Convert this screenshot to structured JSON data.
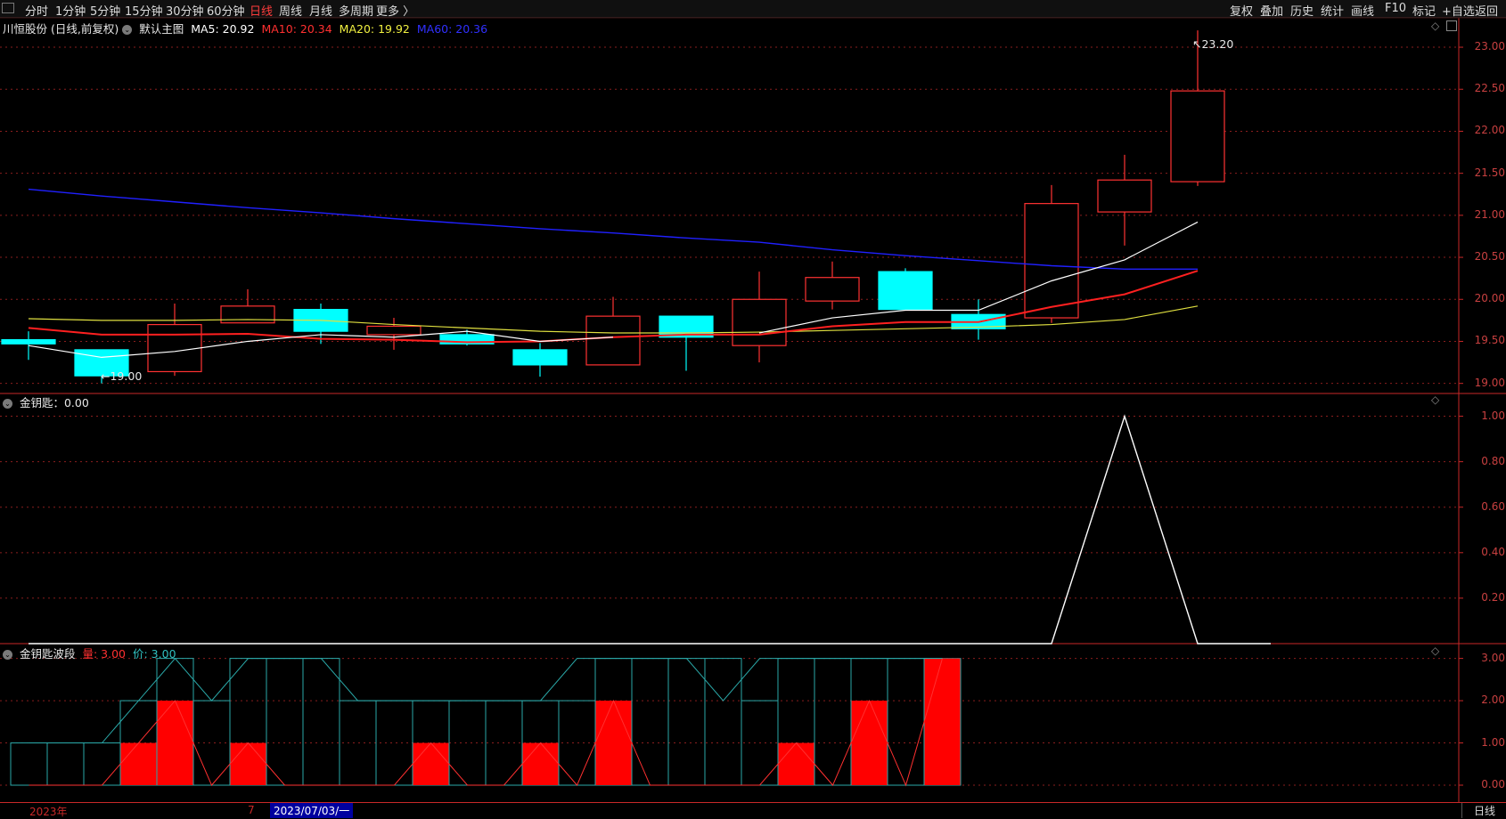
{
  "toolbar": {
    "periods": [
      "分时",
      "1分钟",
      "5分钟",
      "15分钟",
      "30分钟",
      "60分钟",
      "日线",
      "周线",
      "月线",
      "多周期",
      "更多 〉"
    ],
    "active_period": "日线",
    "right_buttons": [
      "复权",
      "叠加",
      "历史",
      "统计",
      "画线",
      "F10",
      "标记",
      "+自选",
      "返回"
    ]
  },
  "main_panel": {
    "stock_name": "川恒股份",
    "mode": "(日线,前复权)",
    "template": "默认主图",
    "ma5_label": "MA5: 20.92",
    "ma10_label": "MA10: 20.34",
    "ma20_label": "MA20: 19.92",
    "ma60_label": "MA60: 20.36",
    "high_marker": "23.20",
    "low_marker": "19.00",
    "y_ticks": [
      "23.00",
      "22.50",
      "22.00",
      "21.50",
      "21.00",
      "20.50",
      "20.00",
      "19.50",
      "19.00"
    ]
  },
  "indicator1": {
    "name": "金钥匙",
    "value_label": "金钥匙：0.00",
    "y_ticks": [
      "1.00",
      "0.80",
      "0.60",
      "0.40",
      "0.20"
    ]
  },
  "indicator2": {
    "name": "金钥匙波段",
    "volume_label": "量: 3.00",
    "price_label": "价: 3.00",
    "y_ticks": [
      "3.00",
      "2.00",
      "1.00",
      "0.00"
    ]
  },
  "footer": {
    "year_label": "2023年",
    "month_label": "7",
    "cursor_date": "2023/07/03/一",
    "period_tab": "日线"
  },
  "colors": {
    "up": "#ff3232",
    "down": "#00ffff",
    "ma5": "#ffffff",
    "ma10": "#ff2020",
    "ma20": "#e0e040",
    "ma60": "#2020ff",
    "grid": "#8a1e1e"
  },
  "chart_data": {
    "type": "candlestick",
    "candles": [
      {
        "o": 19.52,
        "h": 19.62,
        "l": 19.28,
        "c": 19.47
      },
      {
        "o": 19.4,
        "h": 19.4,
        "l": 19.0,
        "c": 19.09
      },
      {
        "o": 19.14,
        "h": 19.95,
        "l": 19.09,
        "c": 19.7
      },
      {
        "o": 19.72,
        "h": 20.12,
        "l": 19.72,
        "c": 19.92
      },
      {
        "o": 19.88,
        "h": 19.95,
        "l": 19.47,
        "c": 19.62
      },
      {
        "o": 19.58,
        "h": 19.78,
        "l": 19.4,
        "c": 19.68
      },
      {
        "o": 19.58,
        "h": 19.64,
        "l": 19.45,
        "c": 19.47
      },
      {
        "o": 19.4,
        "h": 19.48,
        "l": 19.08,
        "c": 19.22
      },
      {
        "o": 19.22,
        "h": 20.03,
        "l": 19.22,
        "c": 19.8
      },
      {
        "o": 19.8,
        "h": 19.8,
        "l": 19.15,
        "c": 19.55
      },
      {
        "o": 19.45,
        "h": 20.33,
        "l": 19.25,
        "c": 20.0
      },
      {
        "o": 19.98,
        "h": 20.45,
        "l": 19.88,
        "c": 20.26
      },
      {
        "o": 20.33,
        "h": 20.37,
        "l": 19.88,
        "c": 19.88
      },
      {
        "o": 19.82,
        "h": 20.0,
        "l": 19.52,
        "c": 19.65
      },
      {
        "o": 19.78,
        "h": 21.36,
        "l": 19.72,
        "c": 21.14
      },
      {
        "o": 21.04,
        "h": 21.72,
        "l": 20.64,
        "c": 21.42
      },
      {
        "o": 21.4,
        "h": 23.2,
        "l": 21.35,
        "c": 22.48
      }
    ],
    "ma5": [
      19.45,
      19.31,
      19.38,
      19.5,
      19.58,
      19.55,
      19.62,
      19.5,
      19.55,
      null,
      19.6,
      19.78,
      19.87,
      19.87,
      20.22,
      20.47,
      20.92
    ],
    "ma10": [
      19.66,
      19.58,
      19.58,
      19.59,
      19.53,
      19.52,
      19.49,
      19.5,
      19.55,
      19.58,
      19.58,
      19.68,
      19.73,
      19.73,
      19.91,
      20.06,
      20.34
    ],
    "ma20": [
      19.77,
      19.75,
      19.75,
      19.76,
      19.75,
      19.7,
      19.66,
      19.62,
      19.6,
      19.6,
      19.61,
      19.63,
      19.65,
      19.67,
      19.7,
      19.76,
      19.92
    ],
    "ma60": [
      21.31,
      21.23,
      21.16,
      21.09,
      21.03,
      20.96,
      20.9,
      20.84,
      20.79,
      20.73,
      20.68,
      20.59,
      20.52,
      20.46,
      20.4,
      20.36,
      20.36
    ],
    "jinyaoshi": [
      0,
      0,
      0,
      0,
      0,
      0,
      0,
      0,
      0,
      0,
      0,
      0,
      0,
      0,
      0,
      1,
      0,
      0
    ],
    "bodian_vol": [
      1,
      1,
      1,
      2,
      3,
      2,
      3,
      3,
      3,
      2,
      2,
      2,
      2,
      2,
      2,
      2,
      3,
      3,
      3,
      3,
      2,
      3,
      3,
      3,
      3,
      3
    ],
    "bodian_red": [
      0,
      0,
      0,
      1,
      2,
      0,
      1,
      0,
      0,
      0,
      0,
      1,
      0,
      0,
      1,
      0,
      2,
      0,
      0,
      0,
      0,
      1,
      0,
      2,
      0,
      3
    ],
    "bodian_price": [
      1,
      1,
      1,
      2,
      3,
      2,
      3,
      3,
      3,
      2,
      2,
      2,
      2,
      2,
      2,
      3,
      3,
      3,
      3,
      2,
      3,
      3,
      3,
      3,
      3,
      3
    ]
  }
}
